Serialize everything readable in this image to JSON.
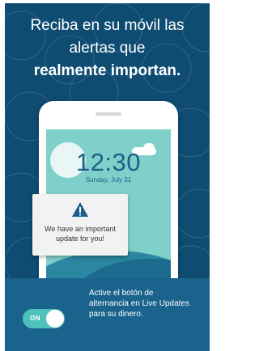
{
  "headline": {
    "line1": "Reciba en su móvil las",
    "line2": "alertas que",
    "line3": "realmente importan."
  },
  "phone": {
    "time": "12:30",
    "date": "Sunday, July 31",
    "alert_text": "We have an important update for you!",
    "alert_icon": "warning-icon"
  },
  "toggle": {
    "label": "ON",
    "state": "on"
  },
  "instruction": "Active el botón de alternancia en Live Updates para su dinero.",
  "colors": {
    "background": "#0f4c72",
    "bottom_bar": "#19638d",
    "toggle_on": "#4fc1bb",
    "screen": "#7fcfcb"
  }
}
